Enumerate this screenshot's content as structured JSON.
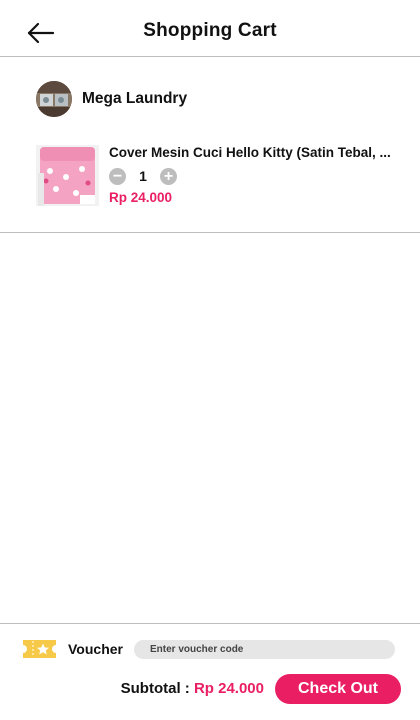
{
  "header": {
    "title": "Shopping Cart",
    "back_icon": "arrow-left-icon"
  },
  "store": {
    "name": "Mega Laundry"
  },
  "cart_item": {
    "title": "Cover Mesin Cuci Hello Kitty (Satin Tebal, ...",
    "quantity": "1",
    "decrement_symbol": "−",
    "increment_symbol": "+",
    "price": "Rp 24.000"
  },
  "voucher": {
    "label": "Voucher",
    "placeholder": "Enter voucher code",
    "icon": "ticket-star-icon"
  },
  "footer": {
    "subtotal_label": "Subtotal :",
    "subtotal_value": "Rp 24.000",
    "checkout_label": "Check Out"
  },
  "colors": {
    "accent": "#e91e63",
    "voucher_icon": "#f7c948",
    "divider": "#bdbdbd",
    "input_bg": "#e6e6e6"
  }
}
